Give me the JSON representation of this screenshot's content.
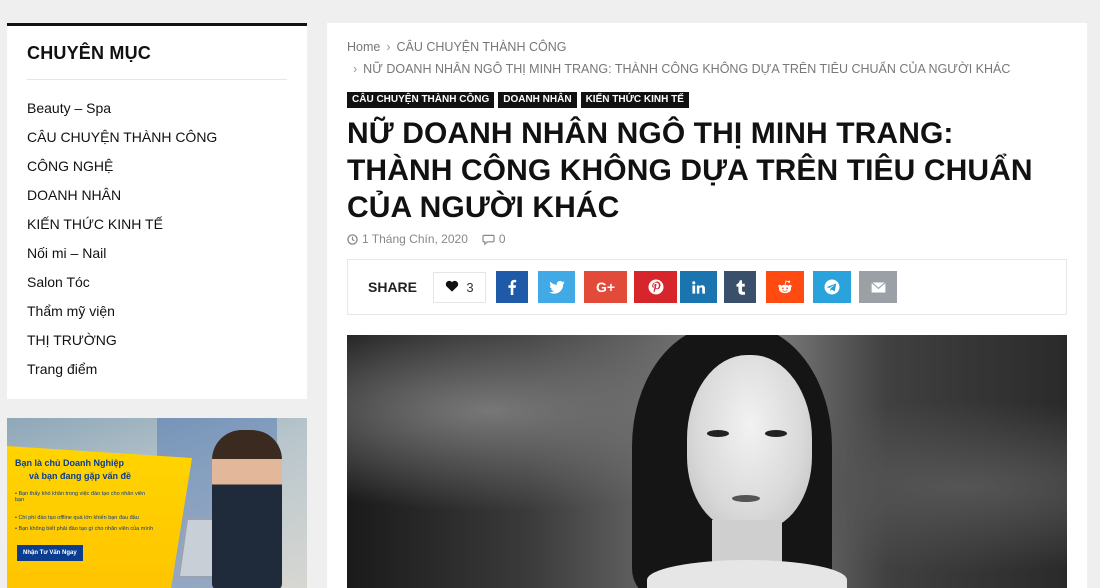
{
  "sidebar": {
    "widget_title": "CHUYÊN MỤC",
    "categories": [
      {
        "label": "Beauty – Spa"
      },
      {
        "label": "CÂU CHUYỆN THÀNH CÔNG"
      },
      {
        "label": "CÔNG NGHỆ"
      },
      {
        "label": "DOANH NHÂN"
      },
      {
        "label": "KIẾN THỨC KINH TẾ"
      },
      {
        "label": "Nối mi – Nail"
      },
      {
        "label": "Salon Tóc"
      },
      {
        "label": "Thẩm mỹ viện"
      },
      {
        "label": "THỊ TRƯỜNG"
      },
      {
        "label": "Trang điểm"
      }
    ],
    "ad": {
      "headline_1": "Bạn là chủ Doanh Nghiệp",
      "headline_2": "và bạn đang gặp vấn đề",
      "bullet_1": "• Bạn thấy khó khăn trong việc đào tạo cho nhân viên bạn",
      "bullet_2": "• Chi phí đào tạo offline quá lớn khiến bạn đau đầu",
      "bullet_3": "• Bạn không biết phải đào tạo gì cho nhân viên của mình",
      "cta": "Nhận Tư Vấn Ngay"
    }
  },
  "article": {
    "breadcrumb": {
      "home": "Home",
      "category": "CÂU CHUYỆN THÀNH CÔNG",
      "current": "NỮ DOANH NHÂN NGÔ THỊ MINH TRANG: THÀNH CÔNG KHÔNG DỰA TRÊN TIÊU CHUẨN CỦA NGƯỜI KHÁC"
    },
    "tags": [
      "CÂU CHUYỆN THÀNH CÔNG",
      "DOANH NHÂN",
      "KIẾN THỨC KINH TẾ"
    ],
    "title": "NỮ DOANH NHÂN NGÔ THỊ MINH TRANG: THÀNH CÔNG KHÔNG DỰA TRÊN TIÊU CHUẨN CỦA NGƯỜI KHÁC",
    "date": "1 Tháng Chín, 2020",
    "comments": "0",
    "share": {
      "label": "SHARE",
      "likes": "3",
      "buttons": [
        {
          "name": "facebook",
          "icon": "facebook-icon",
          "color": "#1f5aa8"
        },
        {
          "name": "twitter",
          "icon": "twitter-icon",
          "color": "#40a9e6"
        },
        {
          "name": "google-plus",
          "icon": "google-plus-icon",
          "color": "#e24a3a"
        },
        {
          "name": "pinterest",
          "icon": "pinterest-icon",
          "color": "#d7262b"
        },
        {
          "name": "linkedin",
          "icon": "linkedin-icon",
          "color": "#1a74b0"
        },
        {
          "name": "tumblr",
          "icon": "tumblr-icon",
          "color": "#3a4f6a"
        },
        {
          "name": "reddit",
          "icon": "reddit-icon",
          "color": "#ff4b12"
        },
        {
          "name": "telegram",
          "icon": "telegram-icon",
          "color": "#2aa2db"
        },
        {
          "name": "email",
          "icon": "email-icon",
          "color": "#9aa0a6"
        }
      ]
    }
  }
}
